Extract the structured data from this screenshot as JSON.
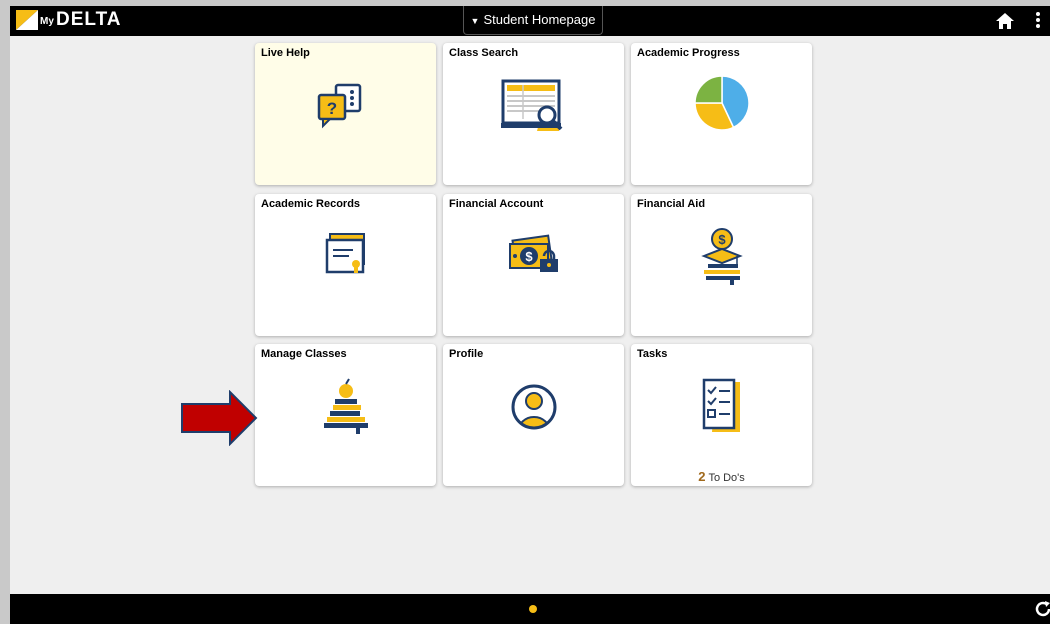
{
  "header": {
    "logo_prefix": "My",
    "logo_name": "DELTA",
    "page_nav_label": "Student Homepage"
  },
  "tiles": [
    {
      "title": "Live Help"
    },
    {
      "title": "Class Search"
    },
    {
      "title": "Academic Progress"
    },
    {
      "title": "Academic Records"
    },
    {
      "title": "Financial Account"
    },
    {
      "title": "Financial Aid"
    },
    {
      "title": "Manage Classes"
    },
    {
      "title": "Profile"
    },
    {
      "title": "Tasks",
      "count": "2",
      "count_label": "To Do's"
    }
  ],
  "colors": {
    "accent": "#f6bd16",
    "navy": "#1f3d6b",
    "highlight_tile": "#fffde8",
    "pointer_arrow": "#c00000"
  },
  "academic_progress_chart": {
    "type": "pie",
    "slices": [
      {
        "color": "#4eaee8",
        "value": 0.43
      },
      {
        "color": "#f6bd16",
        "value": 0.32
      },
      {
        "color": "#7cb342",
        "value": 0.25
      }
    ]
  }
}
